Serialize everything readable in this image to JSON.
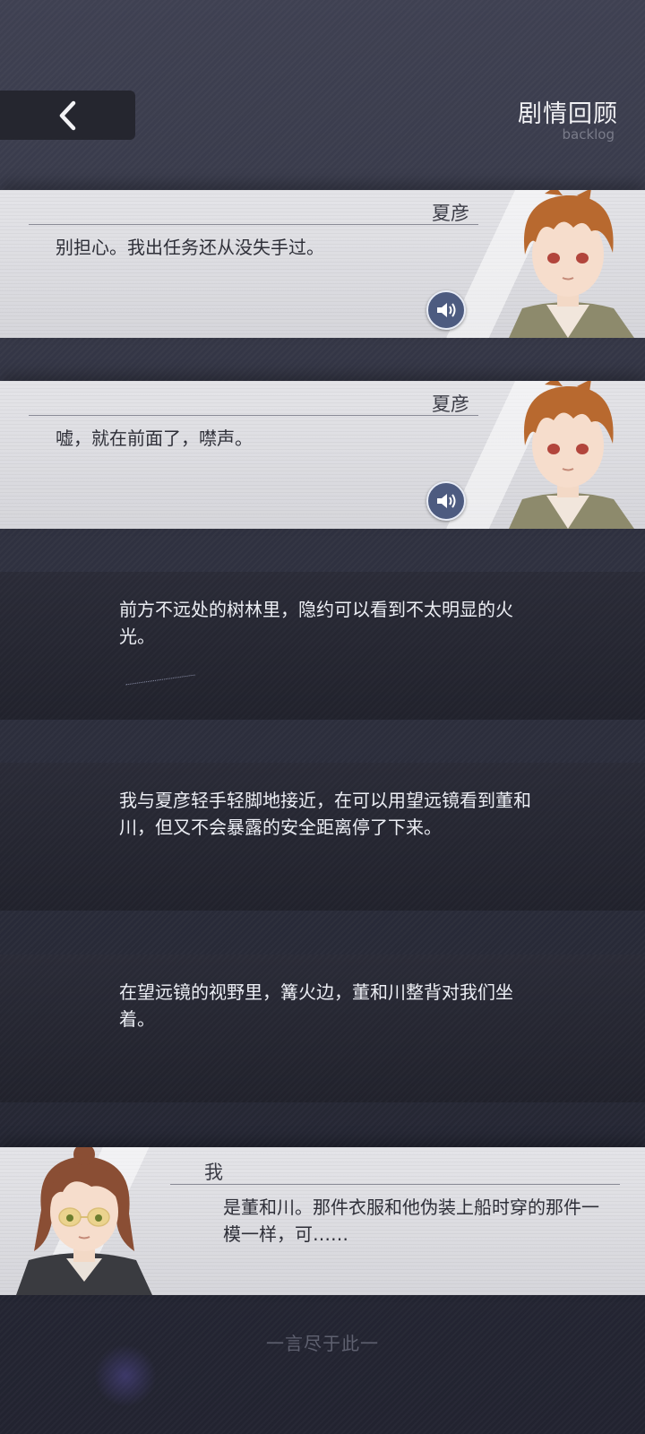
{
  "header": {
    "back_icon": "chevron-left-icon",
    "title": "剧情回顾",
    "subtitle": "backlog"
  },
  "entries": [
    {
      "type": "dialogue",
      "speaker": "夏彦",
      "text": "别担心。我出任务还从没失手过。",
      "voice_icon": "speaker-icon"
    },
    {
      "type": "dialogue",
      "speaker": "夏彦",
      "text": "嘘，就在前面了，噤声。",
      "voice_icon": "speaker-icon"
    },
    {
      "type": "narration",
      "text": "前方不远处的树林里，隐约可以看到不太明显的火光。"
    },
    {
      "type": "narration",
      "text": "我与夏彦轻手轻脚地接近，在可以用望远镜看到董和川，但又不会暴露的安全距离停了下来。"
    },
    {
      "type": "narration",
      "text": "在望远镜的视野里，篝火边，董和川整背对我们坐着。"
    },
    {
      "type": "dialogue",
      "speaker": "我",
      "text": "是董和川。那件衣服和他伪装上船时穿的那件一模一样，可……"
    }
  ],
  "footer": {
    "text": "一言尽于此一"
  }
}
